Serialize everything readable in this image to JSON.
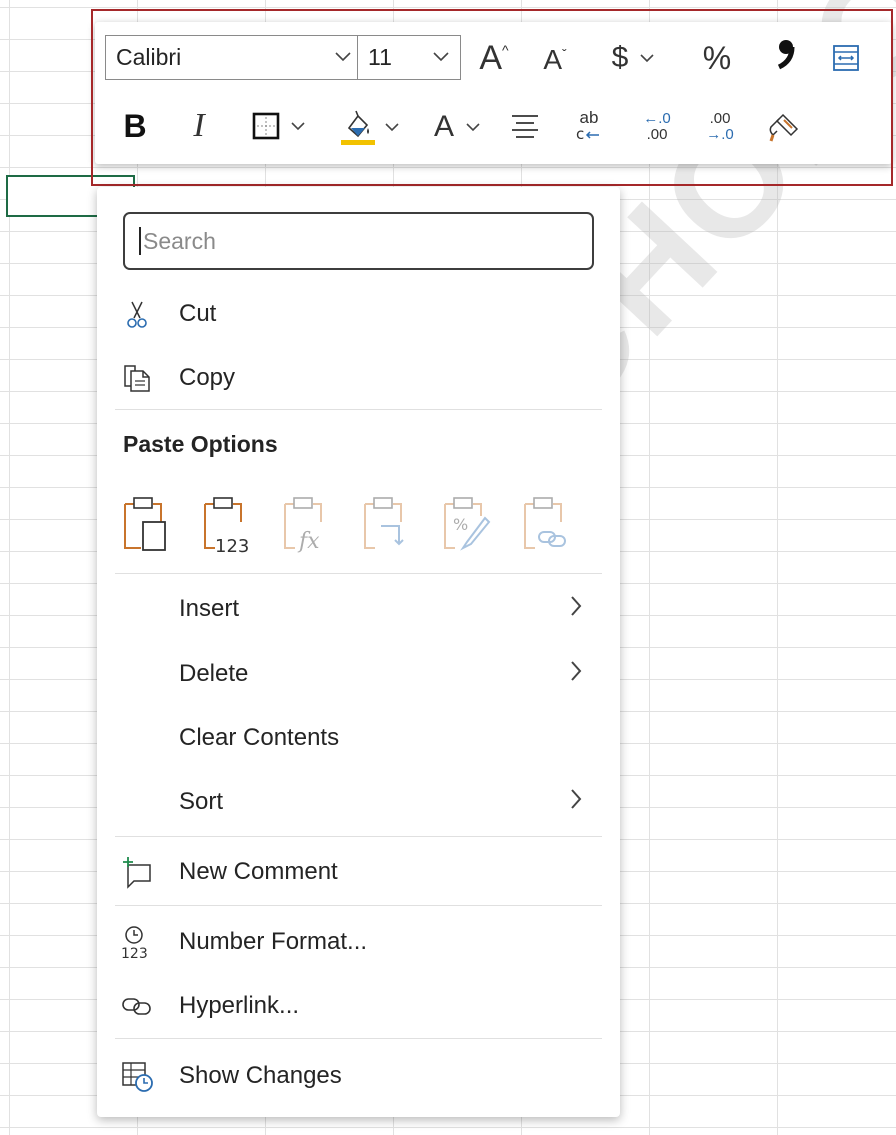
{
  "toolbar": {
    "font_name": "Calibri",
    "font_size": "11",
    "increase_font_glyph": "A",
    "decrease_font_glyph": "A",
    "currency_glyph": "$",
    "percent_glyph": "%",
    "comma_glyph": "❟",
    "bold_glyph": "B",
    "italic_glyph": "I",
    "font_color_glyph": "A",
    "wrap_glyph": "ab",
    "dec_dec_top": "←.0",
    "dec_dec_bottom": ".00",
    "inc_dec_top": ".00",
    "inc_dec_bottom": "→.0"
  },
  "menu": {
    "search_placeholder": "Search",
    "cut": "Cut",
    "copy": "Copy",
    "paste_options": "Paste Options",
    "paste_values_sub": "123",
    "insert": "Insert",
    "delete": "Delete",
    "clear_contents": "Clear Contents",
    "sort": "Sort",
    "new_comment": "New Comment",
    "number_format": "Number Format...",
    "number_format_sub": "123",
    "hyperlink": "Hyperlink...",
    "show_changes": "Show Changes"
  },
  "watermark": {
    "text": "PSYCHOLOGY"
  },
  "colors": {
    "highlight_box": "#a5282a",
    "active_cell": "#1e6b45",
    "fill_yellow": "#f2c200",
    "icon_orange": "#c8742c",
    "icon_blue": "#2b6cb0"
  }
}
